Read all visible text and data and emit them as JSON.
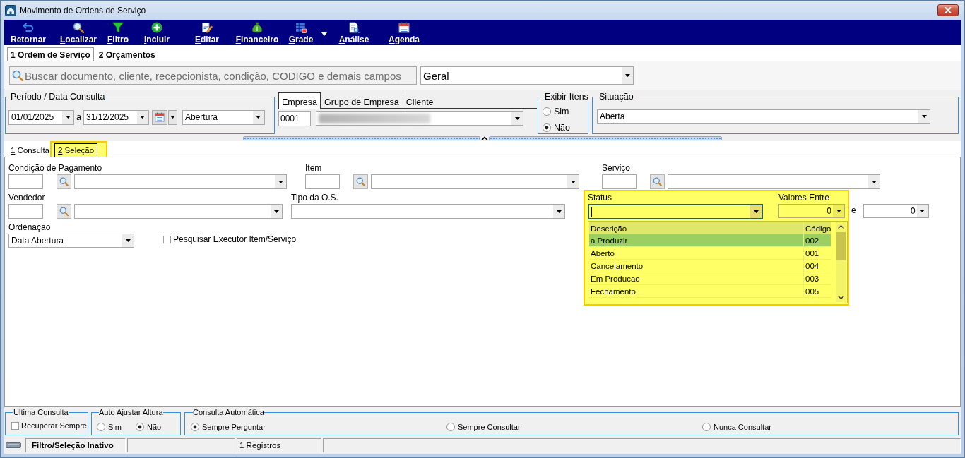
{
  "window": {
    "title": "Movimento de Ordens de Serviço"
  },
  "toolbar": [
    {
      "label": "Retornar",
      "mnemonic": false,
      "dropdown": false
    },
    {
      "label": "Localizar",
      "mnemonic": true,
      "dropdown": false
    },
    {
      "label": "Filtro",
      "mnemonic": true,
      "dropdown": false
    },
    {
      "label": "Incluir",
      "mnemonic": true,
      "dropdown": false
    },
    {
      "label": "Editar",
      "mnemonic": true,
      "dropdown": false
    },
    {
      "label": "Financeiro",
      "mnemonic": true,
      "dropdown": false
    },
    {
      "label": "Grade",
      "mnemonic": true,
      "dropdown": true
    },
    {
      "label": "Análise",
      "mnemonic": true,
      "dropdown": false
    },
    {
      "label": "Agenda",
      "mnemonic": true,
      "dropdown": false
    }
  ],
  "tabs": [
    {
      "label": "1 Ordem de Serviço",
      "selected": true
    },
    {
      "label": "2 Orçamentos",
      "selected": false
    }
  ],
  "search": {
    "placeholder": "Buscar documento, cliente, recepcionista, condição, CODIGO e demais campos",
    "scope": "Geral"
  },
  "period": {
    "legend": "Período / Data Consulta",
    "from": "01/01/2025",
    "separator": "a",
    "to": "31/12/2025",
    "date_field": "Abertura"
  },
  "company": {
    "tabs": [
      {
        "label": "Empresa",
        "selected": true
      },
      {
        "label": "Grupo de Empresa",
        "selected": false
      },
      {
        "label": "Cliente",
        "selected": false
      }
    ],
    "code": "0001",
    "name_blurred": true
  },
  "show_items": {
    "legend": "Exibir Itens",
    "options": [
      {
        "label": "Sim",
        "selected": false
      },
      {
        "label": "Não",
        "selected": true
      }
    ]
  },
  "situation": {
    "legend": "Situação",
    "value": "Aberta"
  },
  "subtabs": [
    {
      "label": "1 Consulta",
      "selected": false,
      "highlighted": false
    },
    {
      "label": "2 Seleção",
      "selected": true,
      "highlighted": true
    }
  ],
  "selection": {
    "lookups": [
      {
        "label": "Condição de Pagamento"
      },
      {
        "label": "Item"
      },
      {
        "label": "Serviço"
      },
      {
        "label": "Vendedor"
      }
    ],
    "service_type": {
      "label": "Tipo da O.S."
    },
    "ordering": {
      "label": "Ordenação",
      "value": "Data Abertura"
    },
    "executor": {
      "label": "Pesquisar Executor Item/Serviço",
      "checked": false
    },
    "status": {
      "label": "Status",
      "highlighted": true,
      "focused": true,
      "expanded": true,
      "columns": [
        "Descrição",
        "Código"
      ],
      "rows": [
        {
          "description": "a Produzir",
          "code": "002",
          "selected": true
        },
        {
          "description": "Aberto",
          "code": "001",
          "selected": false
        },
        {
          "description": "Cancelamento",
          "code": "004",
          "selected": false
        },
        {
          "description": "Em Producao",
          "code": "003",
          "selected": false
        },
        {
          "description": "Fechamento",
          "code": "005",
          "selected": false
        }
      ]
    },
    "values": {
      "label": "Valores Entre",
      "from": "0",
      "joiner": "e",
      "to": "0"
    }
  },
  "options": {
    "last_query": {
      "legend": "Ultima Consulta",
      "checkbox": {
        "label": "Recuperar Sempre",
        "checked": false
      }
    },
    "auto_height": {
      "legend": "Auto Ajustar Altura",
      "options": [
        {
          "label": "Sim",
          "selected": false
        },
        {
          "label": "Não",
          "selected": true
        }
      ]
    },
    "auto_query": {
      "legend": "Consulta Automática",
      "options": [
        {
          "label": "Sempre Perguntar",
          "selected": true
        },
        {
          "label": "Sempre Consultar",
          "selected": false
        },
        {
          "label": "Nunca Consultar",
          "selected": false
        }
      ]
    }
  },
  "status_bar": {
    "filter_state": "Filtro/Seleção Inativo",
    "records": "1 Registros"
  }
}
